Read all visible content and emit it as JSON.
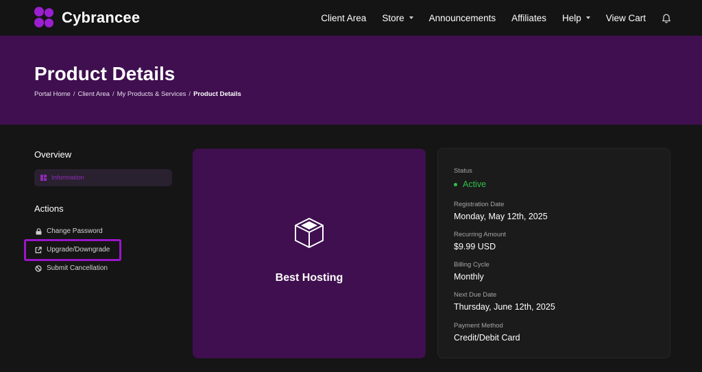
{
  "brand": {
    "name": "Cybrancee",
    "accent": "#9b1fd0"
  },
  "nav": {
    "items": [
      {
        "label": "Client Area",
        "dropdown": false
      },
      {
        "label": "Store",
        "dropdown": true
      },
      {
        "label": "Announcements",
        "dropdown": false
      },
      {
        "label": "Affiliates",
        "dropdown": false
      },
      {
        "label": "Help",
        "dropdown": true
      },
      {
        "label": "View Cart",
        "dropdown": false
      }
    ],
    "notifications_icon": "bell-icon"
  },
  "page": {
    "title": "Product Details",
    "breadcrumb": [
      "Portal Home",
      "Client Area",
      "My Products & Services",
      "Product Details"
    ]
  },
  "sidebar": {
    "overview_heading": "Overview",
    "overview_items": [
      {
        "label": "Information",
        "icon": "dashboard-icon",
        "active": true
      }
    ],
    "actions_heading": "Actions",
    "actions": [
      {
        "label": "Change Password",
        "icon": "lock-icon"
      },
      {
        "label": "Upgrade/Downgrade",
        "icon": "external-link-icon"
      },
      {
        "label": "Submit Cancellation",
        "icon": "ban-icon"
      }
    ]
  },
  "product": {
    "name": "Best Hosting",
    "icon": "cube-icon"
  },
  "details": {
    "status_label": "Status",
    "status_value": "Active",
    "registration_label": "Registration Date",
    "registration_value": "Monday, May 12th, 2025",
    "recurring_label": "Recurring Amount",
    "recurring_value": "$9.99 USD",
    "billing_label": "Billing Cycle",
    "billing_value": "Monthly",
    "due_label": "Next Due Date",
    "due_value": "Thursday, June 12th, 2025",
    "payment_label": "Payment Method",
    "payment_value": "Credit/Debit Card"
  },
  "colors": {
    "hero_bg": "#3f0f4f",
    "status_active": "#30c04c",
    "highlight": "#9b16c9"
  }
}
